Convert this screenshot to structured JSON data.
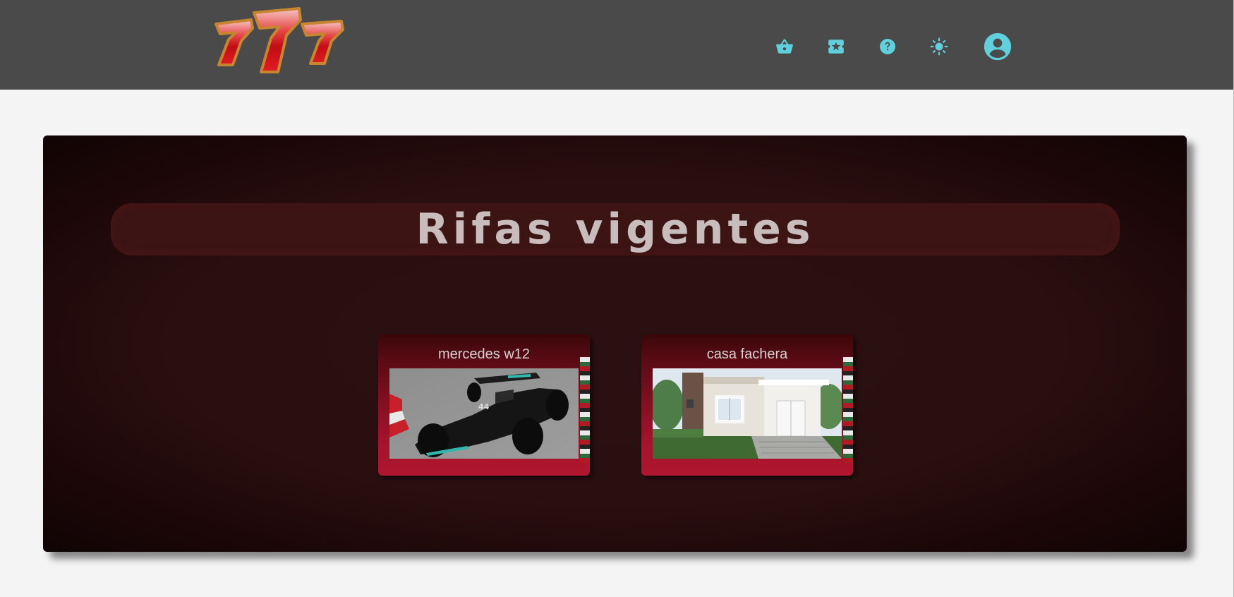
{
  "header": {
    "logo_text": "777",
    "nav": [
      {
        "name": "basket",
        "icon": "shopping-basket-icon"
      },
      {
        "name": "tickets",
        "icon": "ticket-star-icon"
      },
      {
        "name": "help",
        "icon": "help-circle-icon"
      },
      {
        "name": "theme",
        "icon": "sun-icon"
      },
      {
        "name": "account",
        "icon": "account-circle-icon"
      }
    ]
  },
  "main": {
    "title": "Rifas vigentes",
    "raffles": [
      {
        "title": "mercedes w12",
        "image": "formula-one-car-image"
      },
      {
        "title": "casa fachera",
        "image": "house-image"
      }
    ]
  },
  "colors": {
    "header_bg": "#4a4a4a",
    "icon_accent": "#5fd0dc",
    "page_bg": "#f4f4f4",
    "panel_bg": "#2b1011",
    "card_red": "#a3132d"
  }
}
